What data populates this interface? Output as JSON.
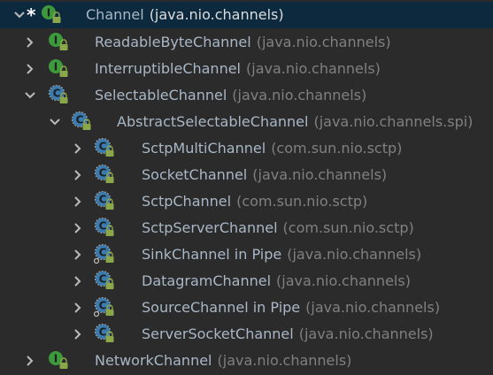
{
  "tree": {
    "rows": [
      {
        "name": "Channel",
        "pkg": "(java.nio.channels)",
        "kind": "interface",
        "expanded": true,
        "selected": true,
        "star": "*"
      },
      {
        "name": "ReadableByteChannel",
        "pkg": "(java.nio.channels)",
        "kind": "interface",
        "expanded": false
      },
      {
        "name": "InterruptibleChannel",
        "pkg": "(java.nio.channels)",
        "kind": "interface",
        "expanded": false
      },
      {
        "name": "SelectableChannel",
        "pkg": "(java.nio.channels)",
        "kind": "abstract-class",
        "expanded": true
      },
      {
        "name": "AbstractSelectableChannel",
        "pkg": "(java.nio.channels.spi)",
        "kind": "abstract-class",
        "expanded": true
      },
      {
        "name": "SctpMultiChannel",
        "pkg": "(com.sun.nio.sctp)",
        "kind": "abstract-class",
        "expanded": false
      },
      {
        "name": "SocketChannel",
        "pkg": "(java.nio.channels)",
        "kind": "abstract-class",
        "expanded": false
      },
      {
        "name": "SctpChannel",
        "pkg": "(com.sun.nio.sctp)",
        "kind": "abstract-class",
        "expanded": false
      },
      {
        "name": "SctpServerChannel",
        "pkg": "(com.sun.nio.sctp)",
        "kind": "abstract-class",
        "expanded": false
      },
      {
        "name": "SinkChannel in Pipe",
        "pkg": "(java.nio.channels)",
        "kind": "abstract-class-static",
        "expanded": false
      },
      {
        "name": "DatagramChannel",
        "pkg": "(java.nio.channels)",
        "kind": "abstract-class",
        "expanded": false
      },
      {
        "name": "SourceChannel in Pipe",
        "pkg": "(java.nio.channels)",
        "kind": "abstract-class-static",
        "expanded": false
      },
      {
        "name": "ServerSocketChannel",
        "pkg": "(java.nio.channels)",
        "kind": "abstract-class",
        "expanded": false
      },
      {
        "name": "NetworkChannel",
        "pkg": "(java.nio.channels)",
        "kind": "interface",
        "expanded": false
      }
    ]
  },
  "colors": {
    "background": "#2b2b2b",
    "selection": "#0d293e",
    "interface_icon": "#3c9a3c",
    "class_icon": "#3a7bb0",
    "lock": "#8aa84a"
  },
  "icons": {
    "interface": "interface-icon",
    "abstract_class": "abstract-class-icon",
    "lock": "lock-icon",
    "expand": "chevron-right-icon",
    "collapse": "chevron-down-icon"
  }
}
